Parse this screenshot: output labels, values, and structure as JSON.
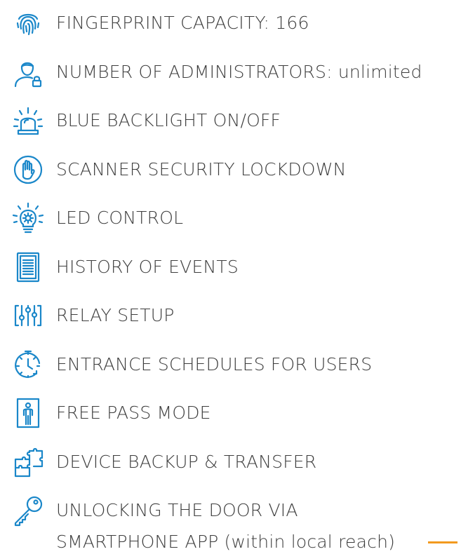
{
  "features": [
    {
      "icon": "fingerprint-icon",
      "label": "FINGERPRINT CAPACITY: 166"
    },
    {
      "icon": "administrator-icon",
      "label": "NUMBER OF ADMINISTRATORS: unlimited"
    },
    {
      "icon": "backlight-icon",
      "label": "BLUE BACKLIGHT ON/OFF"
    },
    {
      "icon": "hand-stop-icon",
      "label": "SCANNER SECURITY LOCKDOWN"
    },
    {
      "icon": "lightbulb-gear-icon",
      "label": "LED CONTROL"
    },
    {
      "icon": "history-document-icon",
      "label": "HISTORY OF EVENTS"
    },
    {
      "icon": "relay-sliders-icon",
      "label": "RELAY SETUP"
    },
    {
      "icon": "schedule-clock-icon",
      "label": "ENTRANCE SCHEDULES FOR USERS"
    },
    {
      "icon": "door-person-icon",
      "label": "FREE PASS MODE"
    },
    {
      "icon": "puzzle-icon",
      "label": "DEVICE BACKUP & TRANSFER"
    },
    {
      "icon": "key-icon",
      "label": "UNLOCKING THE DOOR VIA",
      "label_line2": "SMARTPHONE APP (within local reach)"
    }
  ],
  "colors": {
    "icon": "#1a87c9",
    "text": "#3d3d3d",
    "accent": "#f29a1f"
  }
}
